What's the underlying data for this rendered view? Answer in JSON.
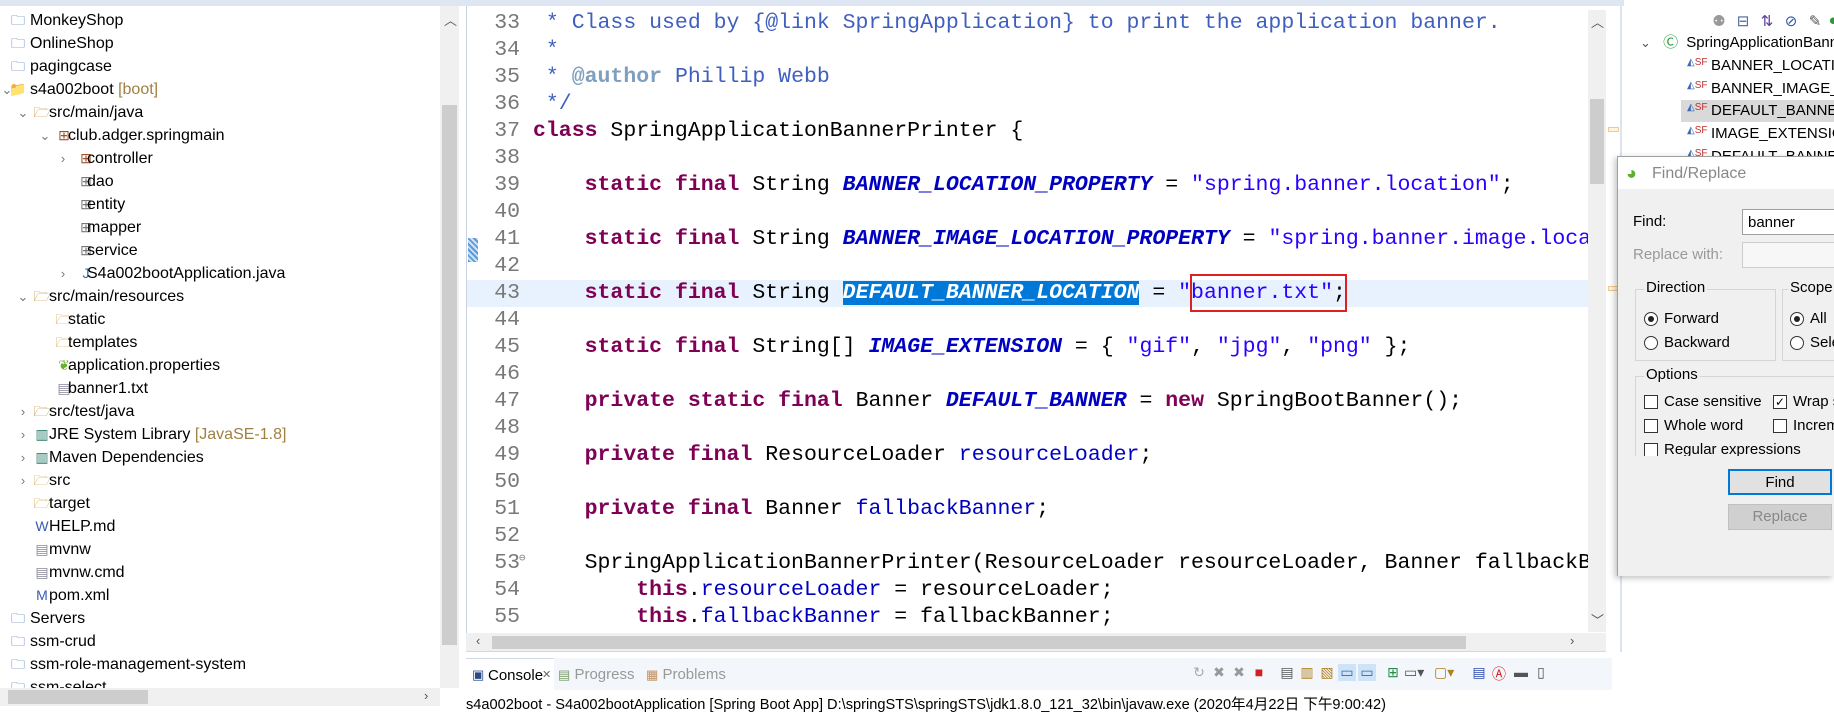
{
  "package_explorer": {
    "items": [
      {
        "label": "MonkeyShop",
        "level": 0,
        "icon": "project-folder-icon"
      },
      {
        "label": "OnlineShop",
        "level": 0,
        "icon": "project-folder-icon"
      },
      {
        "label": "pagingcase",
        "level": 0,
        "icon": "project-folder-icon"
      },
      {
        "label": "s4a002boot",
        "decoration": "[boot]",
        "level": 0,
        "icon": "spring-project-icon",
        "expander": "open"
      },
      {
        "label": "src/main/java",
        "level": 1,
        "icon": "source-folder-icon",
        "expander": "open"
      },
      {
        "label": "club.adger.springmain",
        "level": 2,
        "icon": "package-icon",
        "expander": "open"
      },
      {
        "label": "controller",
        "level": 3,
        "icon": "package-icon",
        "expander": "closed"
      },
      {
        "label": "dao",
        "level": 3,
        "icon": "empty-package-icon"
      },
      {
        "label": "entity",
        "level": 3,
        "icon": "empty-package-icon"
      },
      {
        "label": "mapper",
        "level": 3,
        "icon": "empty-package-icon"
      },
      {
        "label": "service",
        "level": 3,
        "icon": "empty-package-icon"
      },
      {
        "label": "S4a002bootApplication.java",
        "level": 3,
        "icon": "java-file-icon",
        "expander": "closed"
      },
      {
        "label": "src/main/resources",
        "level": 1,
        "icon": "source-folder-icon",
        "expander": "open"
      },
      {
        "label": "static",
        "level": 2,
        "icon": "folder-icon"
      },
      {
        "label": "templates",
        "level": 2,
        "icon": "folder-icon"
      },
      {
        "label": "application.properties",
        "level": 2,
        "icon": "spring-leaf-icon"
      },
      {
        "label": "banner1.txt",
        "level": 2,
        "icon": "text-file-icon"
      },
      {
        "label": "src/test/java",
        "level": 1,
        "icon": "source-folder-icon",
        "expander": "closed"
      },
      {
        "label": "JRE System Library",
        "decoration": "[JavaSE-1.8]",
        "level": 1,
        "icon": "library-icon",
        "expander": "closed"
      },
      {
        "label": "Maven Dependencies",
        "level": 1,
        "icon": "library-icon",
        "expander": "closed"
      },
      {
        "label": "src",
        "level": 1,
        "icon": "folder-icon",
        "expander": "closed"
      },
      {
        "label": "target",
        "level": 1,
        "icon": "folder-icon"
      },
      {
        "label": "HELP.md",
        "level": 1,
        "icon": "markdown-file-icon"
      },
      {
        "label": "mvnw",
        "level": 1,
        "icon": "text-file-icon"
      },
      {
        "label": "mvnw.cmd",
        "level": 1,
        "icon": "text-file-icon"
      },
      {
        "label": "pom.xml",
        "level": 1,
        "icon": "maven-file-icon"
      },
      {
        "label": "Servers",
        "level": 0,
        "icon": "project-folder-icon"
      },
      {
        "label": "ssm-crud",
        "level": 0,
        "icon": "project-folder-icon"
      },
      {
        "label": "ssm-role-management-system",
        "level": 0,
        "icon": "project-folder-icon"
      },
      {
        "label": "ssm-select",
        "level": 0,
        "icon": "project-folder-icon"
      }
    ]
  },
  "editor": {
    "current_line": 43,
    "lines": [
      {
        "n": "33",
        "tokens": [
          [
            " * Class used by {@link SpringApplication} to print the application banner.",
            "comment"
          ]
        ]
      },
      {
        "n": "34",
        "tokens": [
          [
            " *",
            "comment"
          ]
        ]
      },
      {
        "n": "35",
        "tokens": [
          [
            " * ",
            "comment"
          ],
          [
            "@author",
            "tag"
          ],
          [
            " Phillip Webb",
            "comment"
          ]
        ]
      },
      {
        "n": "36",
        "tokens": [
          [
            " */",
            "comment"
          ]
        ]
      },
      {
        "n": "37",
        "tokens": [
          [
            "class",
            "keyword"
          ],
          [
            " SpringApplicationBannerPrinter {",
            "plain"
          ]
        ]
      },
      {
        "n": "38",
        "tokens": []
      },
      {
        "n": "39",
        "tokens": [
          [
            "    ",
            "plain"
          ],
          [
            "static",
            "keyword"
          ],
          [
            " ",
            "plain"
          ],
          [
            "final",
            "keyword"
          ],
          [
            " String ",
            "plain"
          ],
          [
            "BANNER_LOCATION_PROPERTY",
            "sfield"
          ],
          [
            " = ",
            "plain"
          ],
          [
            "\"spring.banner.location\"",
            "string"
          ],
          [
            ";",
            "plain"
          ]
        ]
      },
      {
        "n": "40",
        "tokens": []
      },
      {
        "n": "41",
        "tokens": [
          [
            "    ",
            "plain"
          ],
          [
            "static",
            "keyword"
          ],
          [
            " ",
            "plain"
          ],
          [
            "final",
            "keyword"
          ],
          [
            " String ",
            "plain"
          ],
          [
            "BANNER_IMAGE_LOCATION_PROPERTY",
            "sfield"
          ],
          [
            " = ",
            "plain"
          ],
          [
            "\"spring.banner.image.location\"",
            "string"
          ],
          [
            ";",
            "plain"
          ]
        ]
      },
      {
        "n": "42",
        "tokens": []
      },
      {
        "n": "43",
        "tokens": [
          [
            "    ",
            "plain"
          ],
          [
            "static",
            "keyword"
          ],
          [
            " ",
            "plain"
          ],
          [
            "final",
            "keyword"
          ],
          [
            " String ",
            "plain"
          ],
          [
            "DEFAULT_BANNER_LOCATION",
            "selected"
          ],
          [
            " = ",
            "plain"
          ],
          [
            "\"banner.txt\"",
            "string"
          ],
          [
            ";",
            "plain"
          ]
        ]
      },
      {
        "n": "44",
        "tokens": []
      },
      {
        "n": "45",
        "tokens": [
          [
            "    ",
            "plain"
          ],
          [
            "static",
            "keyword"
          ],
          [
            " ",
            "plain"
          ],
          [
            "final",
            "keyword"
          ],
          [
            " String[] ",
            "plain"
          ],
          [
            "IMAGE_EXTENSION",
            "sfield"
          ],
          [
            " = { ",
            "plain"
          ],
          [
            "\"gif\"",
            "string"
          ],
          [
            ", ",
            "plain"
          ],
          [
            "\"jpg\"",
            "string"
          ],
          [
            ", ",
            "plain"
          ],
          [
            "\"png\"",
            "string"
          ],
          [
            " };",
            "plain"
          ]
        ]
      },
      {
        "n": "46",
        "tokens": []
      },
      {
        "n": "47",
        "tokens": [
          [
            "    ",
            "plain"
          ],
          [
            "private",
            "keyword"
          ],
          [
            " ",
            "plain"
          ],
          [
            "static",
            "keyword"
          ],
          [
            " ",
            "plain"
          ],
          [
            "final",
            "keyword"
          ],
          [
            " Banner ",
            "plain"
          ],
          [
            "DEFAULT_BANNER",
            "sfield"
          ],
          [
            " = ",
            "plain"
          ],
          [
            "new",
            "keyword"
          ],
          [
            " SpringBootBanner();",
            "plain"
          ]
        ]
      },
      {
        "n": "48",
        "tokens": []
      },
      {
        "n": "49",
        "tokens": [
          [
            "    ",
            "plain"
          ],
          [
            "private",
            "keyword"
          ],
          [
            " ",
            "plain"
          ],
          [
            "final",
            "keyword"
          ],
          [
            " ResourceLoader ",
            "plain"
          ],
          [
            "resourceLoader",
            "field"
          ],
          [
            ";",
            "plain"
          ]
        ]
      },
      {
        "n": "50",
        "tokens": []
      },
      {
        "n": "51",
        "tokens": [
          [
            "    ",
            "plain"
          ],
          [
            "private",
            "keyword"
          ],
          [
            " ",
            "plain"
          ],
          [
            "final",
            "keyword"
          ],
          [
            " Banner ",
            "plain"
          ],
          [
            "fallbackBanner",
            "field"
          ],
          [
            ";",
            "plain"
          ]
        ]
      },
      {
        "n": "52",
        "tokens": []
      },
      {
        "n": "53",
        "fold": "⊖",
        "tokens": [
          [
            "    SpringApplicationBannerPrinter(ResourceLoader resourceLoader, Banner fallbackBanner) {",
            "plain"
          ]
        ]
      },
      {
        "n": "54",
        "tokens": [
          [
            "        ",
            "plain"
          ],
          [
            "this",
            "keyword"
          ],
          [
            ".",
            "plain"
          ],
          [
            "resourceLoader",
            "field"
          ],
          [
            " = resourceLoader;",
            "plain"
          ]
        ]
      },
      {
        "n": "55",
        "tokens": [
          [
            "        ",
            "plain"
          ],
          [
            "this",
            "keyword"
          ],
          [
            ".",
            "plain"
          ],
          [
            "fallbackBanner",
            "field"
          ],
          [
            " = fallbackBanner;",
            "plain"
          ]
        ]
      }
    ]
  },
  "outline": {
    "root": "SpringApplicationBannerPrinter",
    "items": [
      "BANNER_LOCATION_PROPERTY",
      "BANNER_IMAGE_LOCATION_PROPERTY",
      "DEFAULT_BANNER_LOCATION",
      "IMAGE_EXTENSION",
      "DEFAULT_BANNER"
    ],
    "selected_index": 2,
    "item_badge": "SF"
  },
  "find_replace": {
    "title": "Find/Replace",
    "find_label": "Find:",
    "find_value": "banner",
    "replace_label": "Replace with:",
    "replace_value": "",
    "direction_label": "Direction",
    "forward_label": "Forward",
    "backward_label": "Backward",
    "direction": "Forward",
    "scope_label": "Scope",
    "scope_all_label": "All",
    "scope_selected_label": "Selected lines",
    "scope": "All",
    "options_label": "Options",
    "case_sensitive_label": "Case sensitive",
    "case_sensitive": false,
    "wrap_label": "Wrap search",
    "wrap": true,
    "whole_word_label": "Whole word",
    "whole_word": false,
    "incremental_label": "Incremental",
    "incremental": false,
    "regex_label": "Regular expressions",
    "regex": false,
    "find_button": "Find",
    "replace_button": "Replace"
  },
  "console": {
    "tabs": [
      {
        "label": "Console",
        "active": true,
        "close": "✕"
      },
      {
        "label": "Progress",
        "active": false
      },
      {
        "label": "Problems",
        "active": false
      }
    ],
    "status": "s4a002boot - S4a002bootApplication [Spring Boot App] D:\\springSTS\\springSTS\\jdk1.8.0_121_32\\bin\\javaw.exe (2020年4月22日 下午9:00:42)"
  },
  "colors": {
    "selection": "#0078d7",
    "current_line": "#e8f2fe",
    "keyword": "#7f0055",
    "string": "#2a00ff",
    "field": "#0000c0",
    "comment": "#3f5fbf",
    "highlight_box": "#e02020"
  }
}
